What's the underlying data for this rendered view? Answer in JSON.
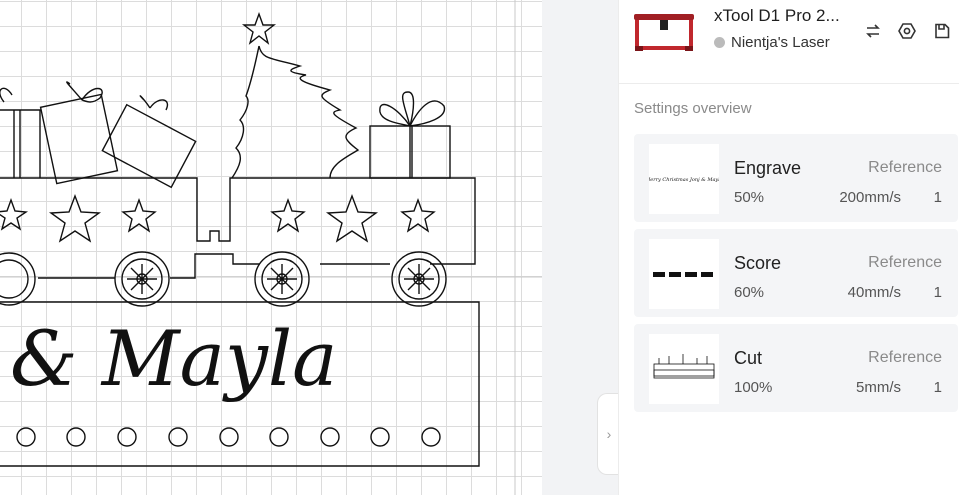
{
  "device": {
    "name": "xTool D1 Pro 2...",
    "status": "Nientja's Laser",
    "icons": [
      "swap-icon",
      "hexagon-settings-icon",
      "save-icon"
    ],
    "accent": "#c0272d"
  },
  "settings": {
    "title": "Settings overview",
    "items": [
      {
        "name": "Engrave",
        "ref": "Reference",
        "power": "50%",
        "speed": "200mm/s",
        "passes": "1"
      },
      {
        "name": "Score",
        "ref": "Reference",
        "power": "60%",
        "speed": "40mm/s",
        "passes": "1"
      },
      {
        "name": "Cut",
        "ref": "Reference",
        "power": "100%",
        "speed": "5mm/s",
        "passes": "1"
      }
    ]
  },
  "canvas": {
    "design_text": "& Mayla"
  },
  "collapse_arrow": "›"
}
